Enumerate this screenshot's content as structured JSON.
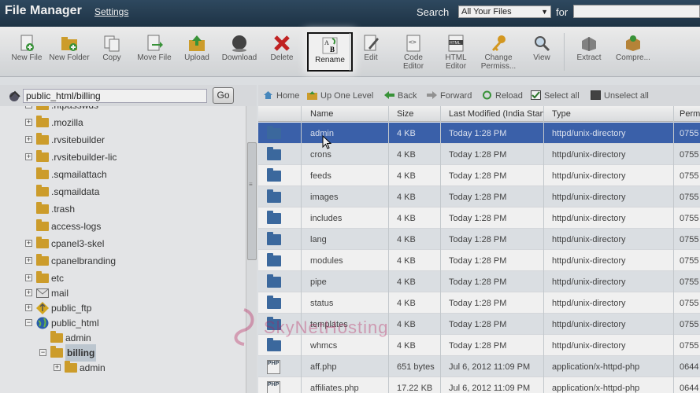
{
  "header": {
    "title": "File Manager",
    "settings": "Settings",
    "search_label": "Search",
    "search_scope": "All Your Files",
    "for_label": "for",
    "search_value": ""
  },
  "toolbar": {
    "buttons": [
      {
        "label": "New File",
        "icon": "new-file-icon"
      },
      {
        "label": "New Folder",
        "icon": "new-folder-icon"
      },
      {
        "label": "Copy",
        "icon": "copy-icon"
      },
      {
        "label": "Move File",
        "icon": "move-file-icon"
      },
      {
        "label": "Upload",
        "icon": "upload-icon"
      },
      {
        "label": "Download",
        "icon": "download-icon"
      },
      {
        "label": "Delete",
        "icon": "delete-icon"
      },
      {
        "label": "Rename",
        "icon": "rename-icon",
        "active": true
      },
      {
        "label": "Edit",
        "icon": "edit-icon"
      },
      {
        "label": "Code Editor",
        "icon": "code-editor-icon"
      },
      {
        "label": "HTML Editor",
        "icon": "html-editor-icon"
      },
      {
        "label": "Change Permiss...",
        "icon": "key-icon"
      },
      {
        "label": "View",
        "icon": "magnifier-icon"
      },
      {
        "label": "Extract",
        "icon": "extract-icon"
      },
      {
        "label": "Compre...",
        "icon": "compress-icon"
      }
    ]
  },
  "directory": {
    "path": "public_html/billing",
    "go": "Go"
  },
  "tree": {
    "items": [
      {
        "label": ".htpasswds",
        "expandable": true,
        "partial": true
      },
      {
        "label": ".mozilla",
        "expandable": true
      },
      {
        "label": ".rvsitebuilder",
        "expandable": true
      },
      {
        "label": ".rvsitebuilder-lic",
        "expandable": true
      },
      {
        "label": ".sqmailattach",
        "expandable": false
      },
      {
        "label": ".sqmaildata",
        "expandable": false
      },
      {
        "label": ".trash",
        "expandable": false
      },
      {
        "label": "access-logs",
        "expandable": false
      },
      {
        "label": "cpanel3-skel",
        "expandable": true
      },
      {
        "label": "cpanelbranding",
        "expandable": true
      },
      {
        "label": "etc",
        "expandable": true
      },
      {
        "label": "mail",
        "expandable": true,
        "icon": "mail-icon"
      },
      {
        "label": "public_ftp",
        "expandable": true,
        "icon": "ftp-icon"
      },
      {
        "label": "public_html",
        "expandable": true,
        "expanded": true,
        "icon": "globe-icon"
      },
      {
        "label": "admin",
        "expandable": false,
        "level": 1
      },
      {
        "label": "billing",
        "expandable": true,
        "expanded": true,
        "level": 1,
        "selected": true
      },
      {
        "label": "admin",
        "expandable": true,
        "level": 2
      }
    ]
  },
  "nav": {
    "home": "Home",
    "up": "Up One Level",
    "back": "Back",
    "forward": "Forward",
    "reload": "Reload",
    "select_all": "Select all",
    "unselect_all": "Unselect all"
  },
  "table": {
    "headers": [
      "Name",
      "Size",
      "Last Modified (India Standard Time)",
      "Type",
      "Perms"
    ],
    "rows": [
      {
        "name": "admin",
        "size": "4 KB",
        "modified": "Today 1:28 PM",
        "type": "httpd/unix-directory",
        "perms": "0755",
        "kind": "folder",
        "selected": true
      },
      {
        "name": "crons",
        "size": "4 KB",
        "modified": "Today 1:28 PM",
        "type": "httpd/unix-directory",
        "perms": "0755",
        "kind": "folder"
      },
      {
        "name": "feeds",
        "size": "4 KB",
        "modified": "Today 1:28 PM",
        "type": "httpd/unix-directory",
        "perms": "0755",
        "kind": "folder"
      },
      {
        "name": "images",
        "size": "4 KB",
        "modified": "Today 1:28 PM",
        "type": "httpd/unix-directory",
        "perms": "0755",
        "kind": "folder"
      },
      {
        "name": "includes",
        "size": "4 KB",
        "modified": "Today 1:28 PM",
        "type": "httpd/unix-directory",
        "perms": "0755",
        "kind": "folder"
      },
      {
        "name": "lang",
        "size": "4 KB",
        "modified": "Today 1:28 PM",
        "type": "httpd/unix-directory",
        "perms": "0755",
        "kind": "folder"
      },
      {
        "name": "modules",
        "size": "4 KB",
        "modified": "Today 1:28 PM",
        "type": "httpd/unix-directory",
        "perms": "0755",
        "kind": "folder"
      },
      {
        "name": "pipe",
        "size": "4 KB",
        "modified": "Today 1:28 PM",
        "type": "httpd/unix-directory",
        "perms": "0755",
        "kind": "folder"
      },
      {
        "name": "status",
        "size": "4 KB",
        "modified": "Today 1:28 PM",
        "type": "httpd/unix-directory",
        "perms": "0755",
        "kind": "folder"
      },
      {
        "name": "templates",
        "size": "4 KB",
        "modified": "Today 1:28 PM",
        "type": "httpd/unix-directory",
        "perms": "0755",
        "kind": "folder"
      },
      {
        "name": "whmcs",
        "size": "4 KB",
        "modified": "Today 1:28 PM",
        "type": "httpd/unix-directory",
        "perms": "0755",
        "kind": "folder"
      },
      {
        "name": "aff.php",
        "size": "651 bytes",
        "modified": "Jul 6, 2012 11:09 PM",
        "type": "application/x-httpd-php",
        "perms": "0644",
        "kind": "php"
      },
      {
        "name": "affiliates.php",
        "size": "17.22 KB",
        "modified": "Jul 6, 2012 11:09 PM",
        "type": "application/x-httpd-php",
        "perms": "0644",
        "kind": "php"
      }
    ]
  },
  "watermark": "SkyNetHosting",
  "colors": {
    "topbar": "#24405a",
    "selected_row": "#3c65b3",
    "folder_blue": "#3d6da6",
    "folder_yellow": "#d9a52c"
  }
}
